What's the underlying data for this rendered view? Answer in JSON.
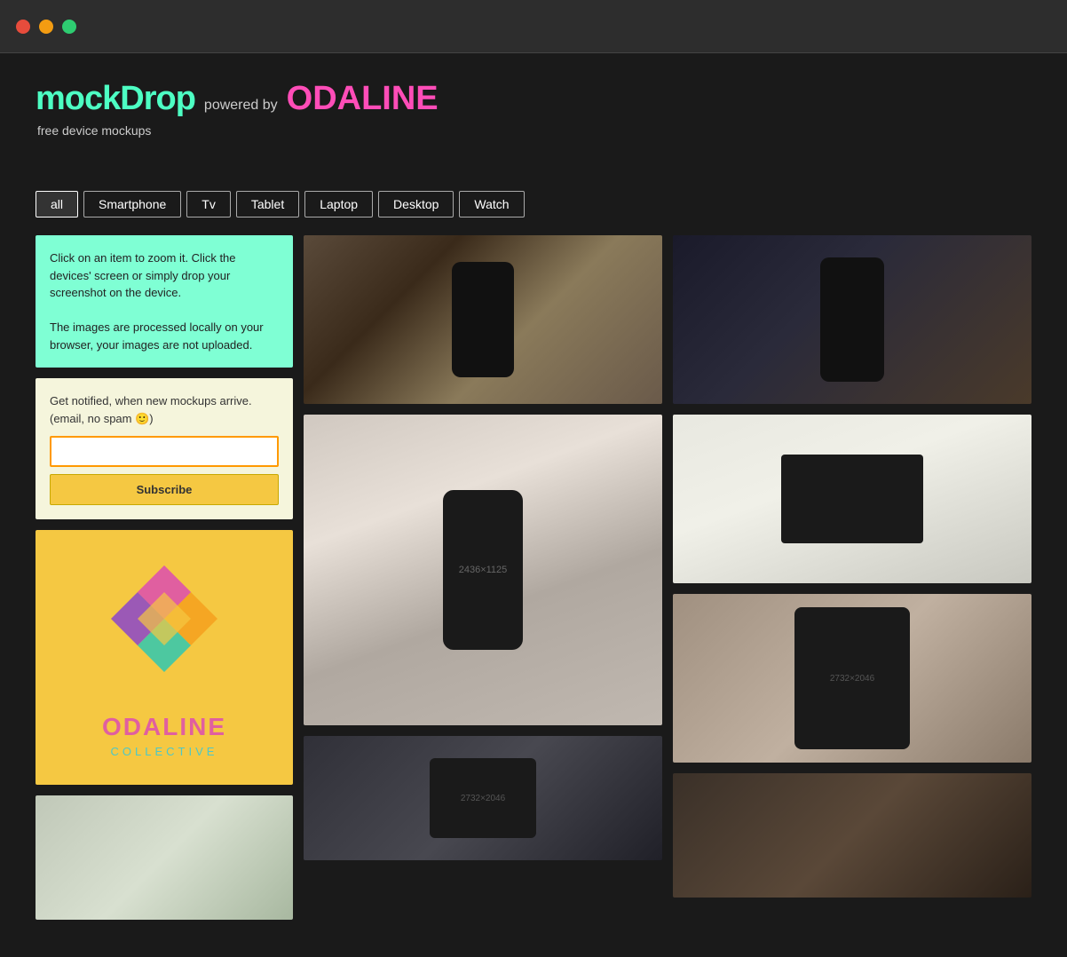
{
  "titlebar": {
    "tl_red": "close",
    "tl_yellow": "minimize",
    "tl_green": "maximize"
  },
  "header": {
    "brand_mock": "mockDrop",
    "powered_by": "powered by",
    "brand_oda": "ODALINE",
    "tagline": "free device mockups"
  },
  "filters": {
    "buttons": [
      "all",
      "Smartphone",
      "Tv",
      "Tablet",
      "Laptop",
      "Desktop",
      "Watch"
    ],
    "active": "all"
  },
  "sidebar": {
    "info_text_1": "Click on an item to zoom it. Click the devices' screen or simply drop your screenshot on the device.",
    "info_text_2": "The images are processed locally on your browser, your images are not uploaded.",
    "notify_label": "Get notified, when new mockups arrive. (email, no spam 🙂)",
    "email_placeholder": "",
    "subscribe_btn": "Subscribe",
    "odaline_name": "ODALINE",
    "collective": "COLLECTIVE"
  },
  "images": {
    "phone3_dim": "2436×1125",
    "tablet2_dim": "2732×2046",
    "tablet_b2_dim": "2732×2046"
  }
}
